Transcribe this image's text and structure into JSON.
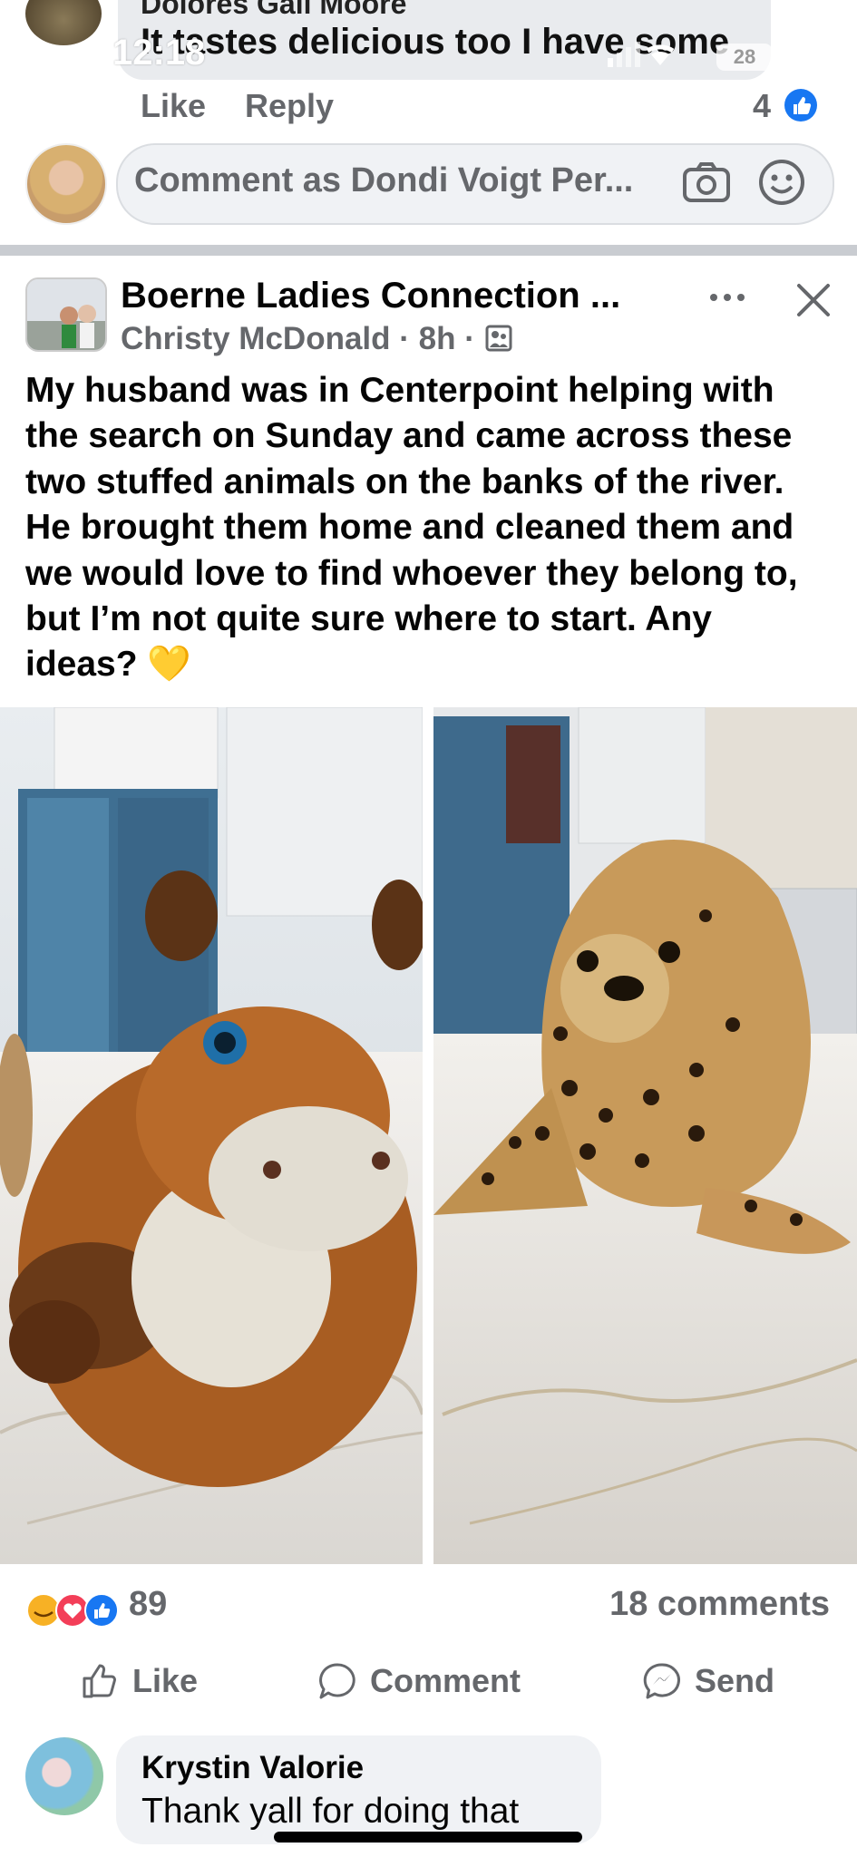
{
  "status_bar": {
    "time": "12:18",
    "battery": "28"
  },
  "previous_comment": {
    "author": "Dolores Gail Moore",
    "text": "It tastes delicious too I have some",
    "like_label": "Like",
    "reply_label": "Reply",
    "reaction_count": "4"
  },
  "comment_composer": {
    "placeholder": "Comment as Dondi Voigt Per..."
  },
  "post": {
    "group_name": "Boerne Ladies Connection ...",
    "author": "Christy McDonald",
    "time": "8h",
    "separator": "·",
    "text": "My husband was in Centerpoint helping with the search on Sunday and came across these two stuffed animals on the banks of the river. He brought them home and cleaned them and we would love to find whoever they belong to, but I’m not quite sure where to start. Any ideas? 💛",
    "reaction_count": "89",
    "comments_count": "18 comments",
    "actions": {
      "like": "Like",
      "comment": "Comment",
      "send": "Send"
    }
  },
  "reply_comment": {
    "author": "Krystin Valorie",
    "text": "Thank yall for doing that"
  },
  "colors": {
    "facebook_blue": "#1877f2",
    "meta_gray": "#65676b",
    "love_red": "#f33e58"
  }
}
